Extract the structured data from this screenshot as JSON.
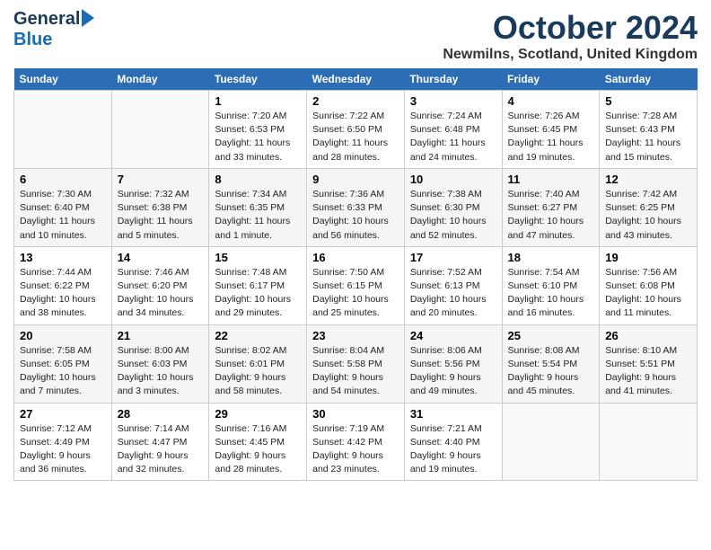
{
  "header": {
    "logo_general": "General",
    "logo_blue": "Blue",
    "month_title": "October 2024",
    "location": "Newmilns, Scotland, United Kingdom"
  },
  "days_of_week": [
    "Sunday",
    "Monday",
    "Tuesday",
    "Wednesday",
    "Thursday",
    "Friday",
    "Saturday"
  ],
  "weeks": [
    {
      "row": 0,
      "cells": [
        {
          "num": "",
          "info": ""
        },
        {
          "num": "",
          "info": ""
        },
        {
          "num": "1",
          "info": "Sunrise: 7:20 AM\nSunset: 6:53 PM\nDaylight: 11 hours\nand 33 minutes."
        },
        {
          "num": "2",
          "info": "Sunrise: 7:22 AM\nSunset: 6:50 PM\nDaylight: 11 hours\nand 28 minutes."
        },
        {
          "num": "3",
          "info": "Sunrise: 7:24 AM\nSunset: 6:48 PM\nDaylight: 11 hours\nand 24 minutes."
        },
        {
          "num": "4",
          "info": "Sunrise: 7:26 AM\nSunset: 6:45 PM\nDaylight: 11 hours\nand 19 minutes."
        },
        {
          "num": "5",
          "info": "Sunrise: 7:28 AM\nSunset: 6:43 PM\nDaylight: 11 hours\nand 15 minutes."
        }
      ]
    },
    {
      "row": 1,
      "cells": [
        {
          "num": "6",
          "info": "Sunrise: 7:30 AM\nSunset: 6:40 PM\nDaylight: 11 hours\nand 10 minutes."
        },
        {
          "num": "7",
          "info": "Sunrise: 7:32 AM\nSunset: 6:38 PM\nDaylight: 11 hours\nand 5 minutes."
        },
        {
          "num": "8",
          "info": "Sunrise: 7:34 AM\nSunset: 6:35 PM\nDaylight: 11 hours\nand 1 minute."
        },
        {
          "num": "9",
          "info": "Sunrise: 7:36 AM\nSunset: 6:33 PM\nDaylight: 10 hours\nand 56 minutes."
        },
        {
          "num": "10",
          "info": "Sunrise: 7:38 AM\nSunset: 6:30 PM\nDaylight: 10 hours\nand 52 minutes."
        },
        {
          "num": "11",
          "info": "Sunrise: 7:40 AM\nSunset: 6:27 PM\nDaylight: 10 hours\nand 47 minutes."
        },
        {
          "num": "12",
          "info": "Sunrise: 7:42 AM\nSunset: 6:25 PM\nDaylight: 10 hours\nand 43 minutes."
        }
      ]
    },
    {
      "row": 2,
      "cells": [
        {
          "num": "13",
          "info": "Sunrise: 7:44 AM\nSunset: 6:22 PM\nDaylight: 10 hours\nand 38 minutes."
        },
        {
          "num": "14",
          "info": "Sunrise: 7:46 AM\nSunset: 6:20 PM\nDaylight: 10 hours\nand 34 minutes."
        },
        {
          "num": "15",
          "info": "Sunrise: 7:48 AM\nSunset: 6:17 PM\nDaylight: 10 hours\nand 29 minutes."
        },
        {
          "num": "16",
          "info": "Sunrise: 7:50 AM\nSunset: 6:15 PM\nDaylight: 10 hours\nand 25 minutes."
        },
        {
          "num": "17",
          "info": "Sunrise: 7:52 AM\nSunset: 6:13 PM\nDaylight: 10 hours\nand 20 minutes."
        },
        {
          "num": "18",
          "info": "Sunrise: 7:54 AM\nSunset: 6:10 PM\nDaylight: 10 hours\nand 16 minutes."
        },
        {
          "num": "19",
          "info": "Sunrise: 7:56 AM\nSunset: 6:08 PM\nDaylight: 10 hours\nand 11 minutes."
        }
      ]
    },
    {
      "row": 3,
      "cells": [
        {
          "num": "20",
          "info": "Sunrise: 7:58 AM\nSunset: 6:05 PM\nDaylight: 10 hours\nand 7 minutes."
        },
        {
          "num": "21",
          "info": "Sunrise: 8:00 AM\nSunset: 6:03 PM\nDaylight: 10 hours\nand 3 minutes."
        },
        {
          "num": "22",
          "info": "Sunrise: 8:02 AM\nSunset: 6:01 PM\nDaylight: 9 hours\nand 58 minutes."
        },
        {
          "num": "23",
          "info": "Sunrise: 8:04 AM\nSunset: 5:58 PM\nDaylight: 9 hours\nand 54 minutes."
        },
        {
          "num": "24",
          "info": "Sunrise: 8:06 AM\nSunset: 5:56 PM\nDaylight: 9 hours\nand 49 minutes."
        },
        {
          "num": "25",
          "info": "Sunrise: 8:08 AM\nSunset: 5:54 PM\nDaylight: 9 hours\nand 45 minutes."
        },
        {
          "num": "26",
          "info": "Sunrise: 8:10 AM\nSunset: 5:51 PM\nDaylight: 9 hours\nand 41 minutes."
        }
      ]
    },
    {
      "row": 4,
      "cells": [
        {
          "num": "27",
          "info": "Sunrise: 7:12 AM\nSunset: 4:49 PM\nDaylight: 9 hours\nand 36 minutes."
        },
        {
          "num": "28",
          "info": "Sunrise: 7:14 AM\nSunset: 4:47 PM\nDaylight: 9 hours\nand 32 minutes."
        },
        {
          "num": "29",
          "info": "Sunrise: 7:16 AM\nSunset: 4:45 PM\nDaylight: 9 hours\nand 28 minutes."
        },
        {
          "num": "30",
          "info": "Sunrise: 7:19 AM\nSunset: 4:42 PM\nDaylight: 9 hours\nand 23 minutes."
        },
        {
          "num": "31",
          "info": "Sunrise: 7:21 AM\nSunset: 4:40 PM\nDaylight: 9 hours\nand 19 minutes."
        },
        {
          "num": "",
          "info": ""
        },
        {
          "num": "",
          "info": ""
        }
      ]
    }
  ]
}
